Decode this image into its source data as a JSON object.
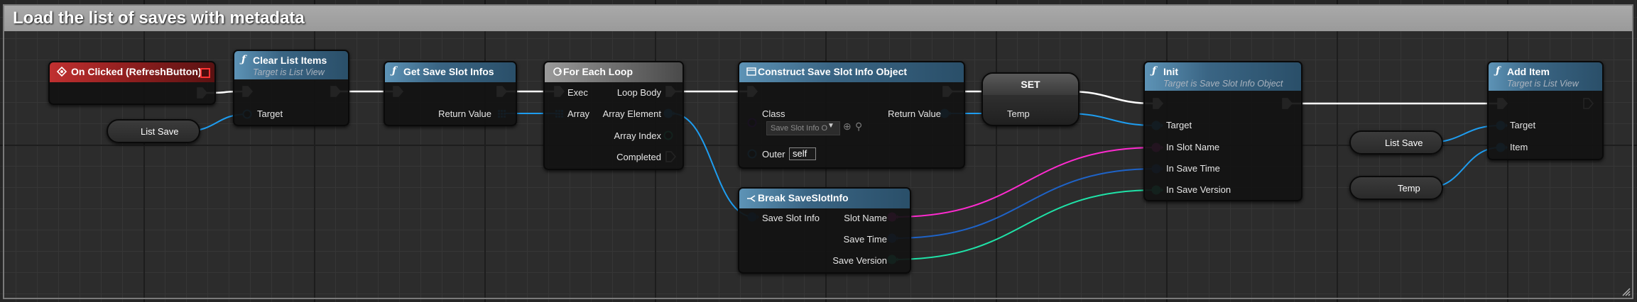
{
  "comment": {
    "title": "Load the list of saves with metadata"
  },
  "colors": {
    "exec": "#ffffff",
    "object": "#1e9df0",
    "string": "#ff2bd0",
    "integer": "#1fe3a8",
    "struct": "#0b5ea8",
    "datetime": "#1e63c8",
    "class": "#6b00c9"
  },
  "nodes": {
    "on_clicked": {
      "title": "On Clicked (RefreshButton)",
      "icon": "event-diamond-icon"
    },
    "clear_list": {
      "title": "Clear List Items",
      "subtitle": "Target is List View",
      "pins": {
        "target": "Target"
      }
    },
    "list_save_var_1": {
      "label": "List Save"
    },
    "get_save_slot_infos": {
      "title": "Get Save Slot Infos",
      "pins": {
        "return_value": "Return Value"
      }
    },
    "for_each": {
      "title": "For Each Loop",
      "pins": {
        "exec": "Exec",
        "array": "Array",
        "loop_body": "Loop Body",
        "array_element": "Array Element",
        "array_index": "Array Index",
        "completed": "Completed"
      }
    },
    "construct": {
      "title": "Construct Save Slot Info Object",
      "pins": {
        "class": "Class",
        "return_value": "Return Value",
        "outer": "Outer"
      },
      "class_value": "Save Slot Info O",
      "outer_value": "self"
    },
    "break_info": {
      "title": "Break SaveSlotInfo",
      "pins": {
        "save_slot_info": "Save Slot Info",
        "slot_name": "Slot Name",
        "save_time": "Save Time",
        "save_version": "Save Version"
      }
    },
    "set_node": {
      "title": "SET",
      "pins": {
        "temp": "Temp"
      }
    },
    "init": {
      "title": "Init",
      "subtitle": "Target is Save Slot Info Object",
      "pins": {
        "target": "Target",
        "in_slot_name": "In Slot Name",
        "in_save_time": "In Save Time",
        "in_save_version": "In Save Version"
      }
    },
    "list_save_var_2": {
      "label": "List Save"
    },
    "temp_var": {
      "label": "Temp"
    },
    "add_item": {
      "title": "Add Item",
      "subtitle": "Target is List View",
      "pins": {
        "target": "Target",
        "item": "Item"
      }
    }
  }
}
